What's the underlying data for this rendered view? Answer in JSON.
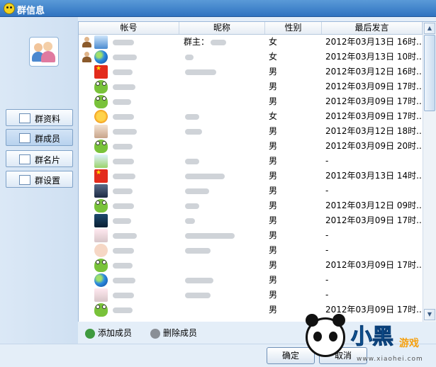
{
  "window": {
    "title": "群信息"
  },
  "nav": [
    {
      "label": "群资料",
      "active": false
    },
    {
      "label": "群成员",
      "active": true
    },
    {
      "label": "群名片",
      "active": false
    },
    {
      "label": "群设置",
      "active": false
    }
  ],
  "table": {
    "columns": [
      "帐号",
      "昵称",
      "性别",
      "最后发言"
    ],
    "rows": [
      {
        "role": "owner",
        "avatar": "fish-icon",
        "nickname": "群主：",
        "gender": "女",
        "last": "2012年03月13日 16时..."
      },
      {
        "role": "admin",
        "avatar": "globe-icon",
        "nickname": "",
        "gender": "女",
        "last": "2012年03月13日 10时..."
      },
      {
        "role": "",
        "avatar": "flag-icon",
        "nickname": "",
        "gender": "男",
        "last": "2012年03月12日 16时..."
      },
      {
        "role": "",
        "avatar": "frog-icon",
        "nickname": "",
        "gender": "男",
        "last": "2012年03月09日 17时..."
      },
      {
        "role": "",
        "avatar": "frog-icon",
        "nickname": "",
        "gender": "男",
        "last": "2012年03月09日 17时..."
      },
      {
        "role": "",
        "avatar": "sun-icon",
        "nickname": "",
        "gender": "女",
        "last": "2012年03月09日 17时..."
      },
      {
        "role": "",
        "avatar": "person-icon",
        "nickname": "",
        "gender": "男",
        "last": "2012年03月12日 18时..."
      },
      {
        "role": "",
        "avatar": "frog-icon",
        "nickname": "",
        "gender": "男",
        "last": "2012年03月09日 20时..."
      },
      {
        "role": "",
        "avatar": "plant-icon",
        "nickname": "",
        "gender": "男",
        "last": "-"
      },
      {
        "role": "",
        "avatar": "flag-icon",
        "nickname": "",
        "gender": "男",
        "last": "2012年03月13日 14时..."
      },
      {
        "role": "",
        "avatar": "dark-icon",
        "nickname": "",
        "gender": "男",
        "last": "-"
      },
      {
        "role": "",
        "avatar": "frog-icon",
        "nickname": "",
        "gender": "男",
        "last": "2012年03月12日 09时..."
      },
      {
        "role": "",
        "avatar": "tech-icon",
        "nickname": "",
        "gender": "男",
        "last": "2012年03月09日 17时..."
      },
      {
        "role": "",
        "avatar": "anime-icon",
        "nickname": "",
        "gender": "男",
        "last": "-"
      },
      {
        "role": "",
        "avatar": "baby-icon",
        "nickname": "",
        "gender": "男",
        "last": "-"
      },
      {
        "role": "",
        "avatar": "frog-icon",
        "nickname": "",
        "gender": "男",
        "last": "2012年03月09日 17时..."
      },
      {
        "role": "",
        "avatar": "globe-icon",
        "nickname": "",
        "gender": "男",
        "last": "-"
      },
      {
        "role": "",
        "avatar": "anime-icon",
        "nickname": "",
        "gender": "男",
        "last": "-"
      },
      {
        "role": "",
        "avatar": "frog-icon",
        "nickname": "",
        "gender": "男",
        "last": "2012年03月09日 17时..."
      }
    ]
  },
  "actions": {
    "add_member": "添加成员",
    "remove_member": "删除成员"
  },
  "buttons": {
    "ok": "确定",
    "cancel": "取消"
  },
  "watermark": {
    "brand": "小黑",
    "brand_sub": "游戏",
    "site": "www.xiaohei.com"
  }
}
